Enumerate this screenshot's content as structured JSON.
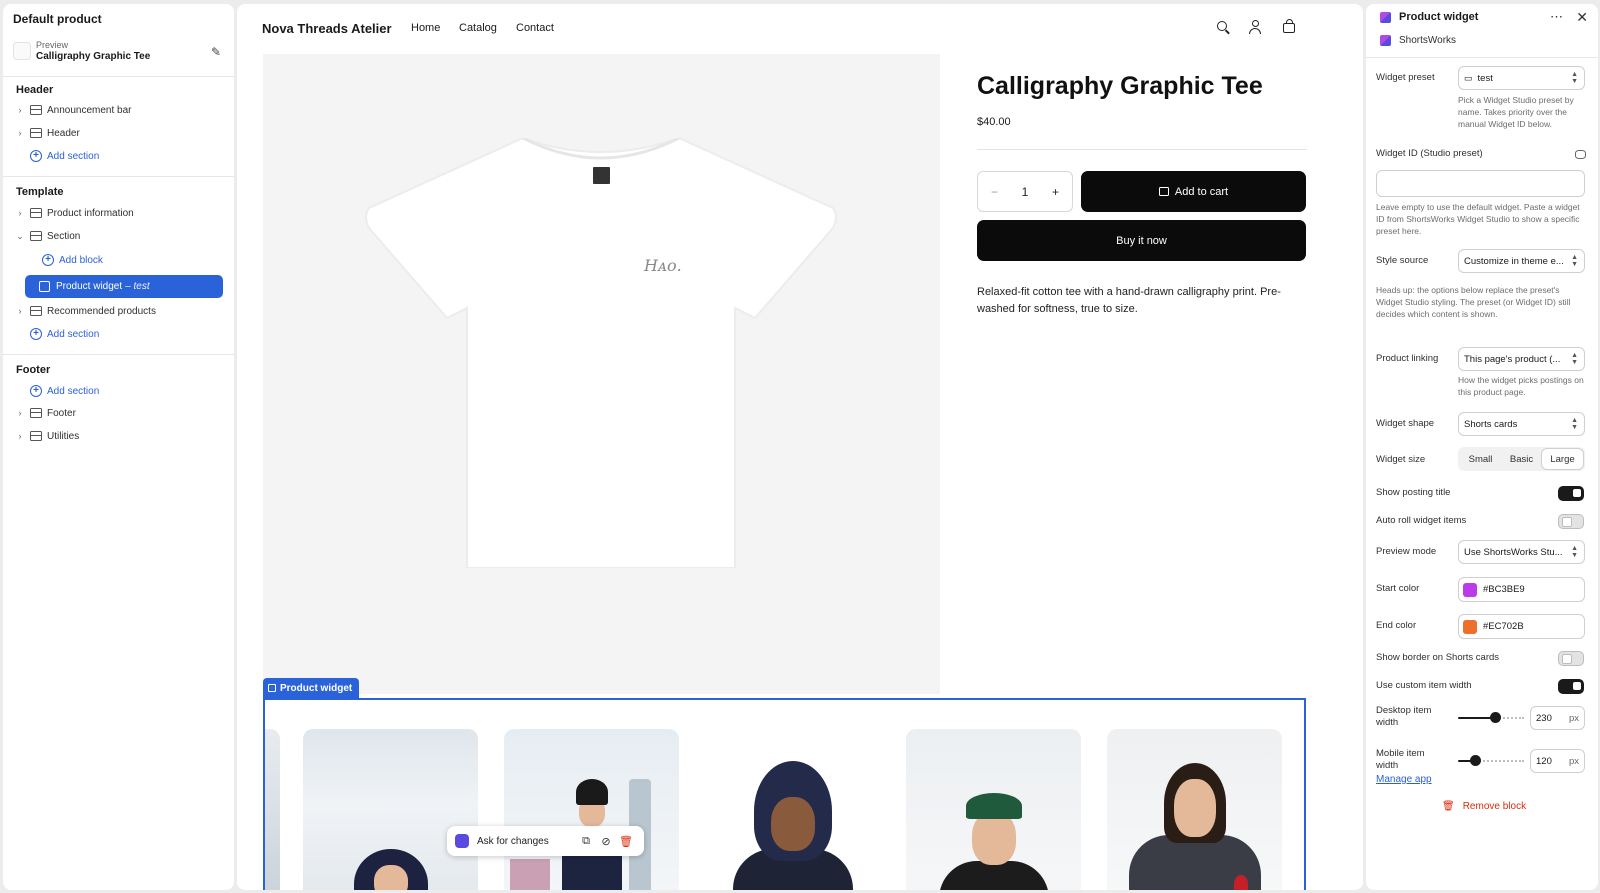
{
  "left": {
    "title": "Default product",
    "preview_label": "Preview",
    "preview_name": "Calligraphy Graphic Tee",
    "header_group": "Header",
    "header_items": [
      "Announcement bar",
      "Header"
    ],
    "add_section": "Add section",
    "template_group": "Template",
    "template_items": [
      "Product information",
      "Section"
    ],
    "add_block": "Add block",
    "selected_block": "Product widget",
    "selected_block_suffix": "– test",
    "recommended": "Recommended products",
    "footer_group": "Footer",
    "footer_items": [
      "Footer",
      "Utilities"
    ]
  },
  "store": {
    "brand": "Nova Threads Atelier",
    "nav": [
      "Home",
      "Catalog",
      "Contact"
    ],
    "tee_script": "Hᴀᴏ.",
    "product_title": "Calligraphy Graphic Tee",
    "price": "$40.00",
    "qty_minus": "−",
    "qty": "1",
    "qty_plus": "+",
    "add_to_cart": "Add to cart",
    "buy_now": "Buy it now",
    "description": "Relaxed-fit cotton tee with a hand-drawn calligraphy print. Pre-washed for softness, true to size.",
    "widget_label": "Product widget",
    "ask_for_changes": "Ask for changes"
  },
  "right": {
    "title": "Product widget",
    "app_name": "ShortsWorks",
    "widget_preset_label": "Widget preset",
    "widget_preset_value": "test",
    "widget_preset_help": "Pick a Widget Studio preset by name. Takes priority over the manual Widget ID below.",
    "widget_id_label": "Widget ID (Studio preset)",
    "widget_id_help": "Leave empty to use the default widget. Paste a widget ID from ShortsWorks Widget Studio to show a specific preset here.",
    "style_source_label": "Style source",
    "style_source_value": "Customize in theme e...",
    "style_source_help": "Heads up: the options below replace the preset's Widget Studio styling. The preset (or Widget ID) still decides which content is shown.",
    "product_linking_label": "Product linking",
    "product_linking_value": "This page's product (...",
    "product_linking_help": "How the widget picks postings on this product page.",
    "widget_shape_label": "Widget shape",
    "widget_shape_value": "Shorts cards",
    "widget_size_label": "Widget size",
    "widget_size_options": [
      "Small",
      "Basic",
      "Large"
    ],
    "widget_size_selected": "Large",
    "show_posting_title_label": "Show posting title",
    "show_posting_title_on": true,
    "auto_roll_label": "Auto roll widget items",
    "auto_roll_on": false,
    "preview_mode_label": "Preview mode",
    "preview_mode_value": "Use ShortsWorks Stu...",
    "start_color_label": "Start color",
    "start_color": "#BC3BE9",
    "end_color_label": "End color",
    "end_color": "#EC702B",
    "show_border_label": "Show border on Shorts cards",
    "show_border_on": false,
    "custom_width_label": "Use custom item width",
    "custom_width_on": true,
    "desktop_width_label": "Desktop item width",
    "desktop_width": "230",
    "mobile_width_label": "Mobile item width",
    "mobile_width": "120",
    "unit": "px",
    "manage_app": "Manage app",
    "remove_block": "Remove block"
  },
  "colors": {
    "accent": "#2A63D9",
    "danger": "#D72C0D",
    "button": "#0B0B0B"
  }
}
